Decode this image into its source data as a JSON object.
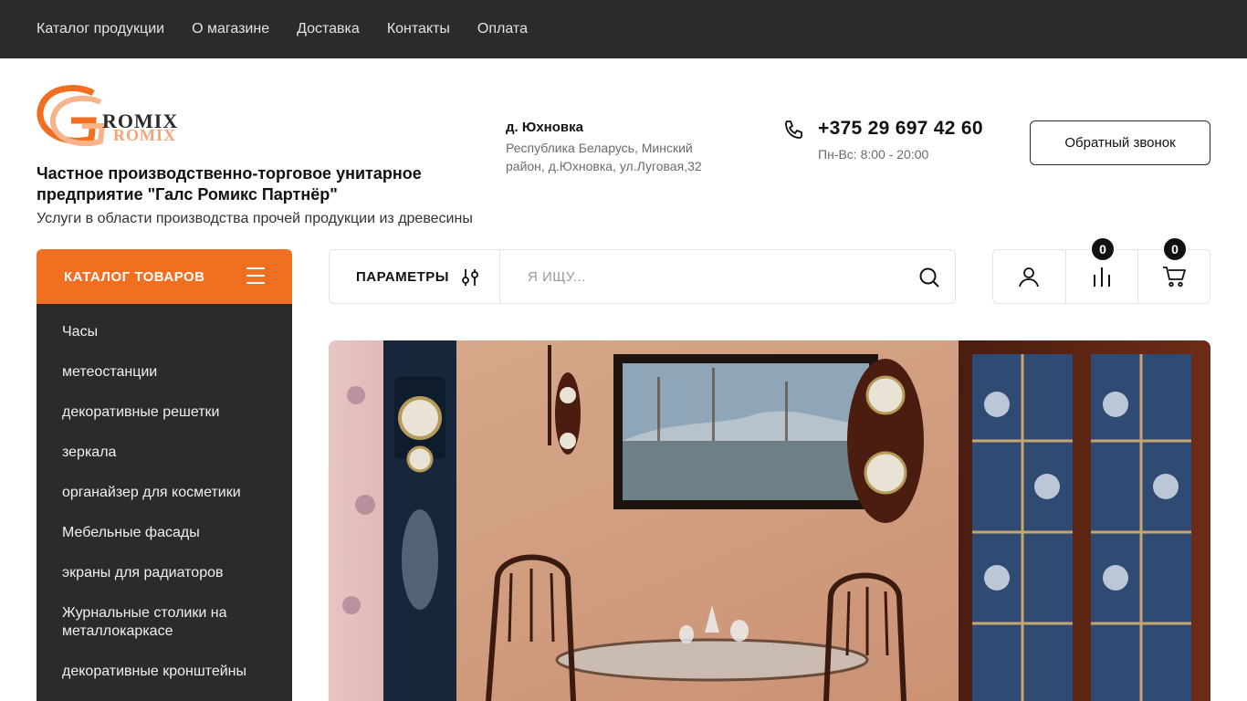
{
  "topnav": {
    "items": [
      "Каталог продукции",
      "О магазине",
      "Доставка",
      "Контакты",
      "Оплата"
    ]
  },
  "header": {
    "logo_text": "GROMIX ROMIX",
    "company_name": "Частное производственно-торговое унитарное предприятие \"Галс Ромикс Партнёр\"",
    "company_subtitle": "Услуги в области производства прочей продукции из древесины",
    "address_title": "д. Юхновка",
    "address_text": "Республика Беларусь, Минский район, д.Юхновка, ул.Луговая,32",
    "phone": "+375 29 697 42 60",
    "hours": "Пн-Вс: 8:00 - 20:00",
    "callback_label": "Обратный звонок"
  },
  "catalog": {
    "title": "КАТАЛОГ ТОВАРОВ",
    "items": [
      "Часы",
      "метеостанции",
      "декоративные решетки",
      "зеркала",
      "органайзер для косметики",
      "Мебельные фасады",
      "экраны для радиаторов",
      "Журнальные столики на металлокаркасе",
      "декоративные кронштейны"
    ]
  },
  "search": {
    "params_label": "ПАРАМЕТРЫ",
    "placeholder": "Я ИЩУ..."
  },
  "user_icons": {
    "compare_count": "0",
    "cart_count": "0"
  },
  "colors": {
    "accent": "#f26f22",
    "dark": "#2b2b2b"
  }
}
